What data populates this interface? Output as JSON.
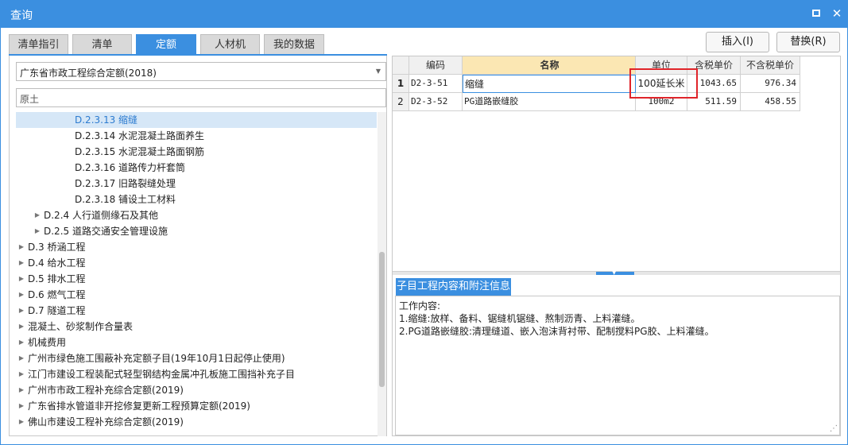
{
  "window": {
    "title": "查询"
  },
  "tabs": [
    {
      "label": "清单指引",
      "active": false
    },
    {
      "label": "清单",
      "active": false
    },
    {
      "label": "定额",
      "active": true
    },
    {
      "label": "人材机",
      "active": false
    },
    {
      "label": "我的数据",
      "active": false
    }
  ],
  "buttons": {
    "insert": "插入(I)",
    "replace": "替换(R)"
  },
  "left": {
    "quota_select": "广东省市政工程综合定额(2018)",
    "search_value": "原土",
    "tree": [
      {
        "label": "D.2.3.13 缩缝",
        "level": 3,
        "arrow": "",
        "selected": true
      },
      {
        "label": "D.2.3.14 水泥混凝土路面养生",
        "level": 3,
        "arrow": ""
      },
      {
        "label": "D.2.3.15 水泥混凝土路面钢筋",
        "level": 3,
        "arrow": ""
      },
      {
        "label": "D.2.3.16 道路传力杆套筒",
        "level": 3,
        "arrow": ""
      },
      {
        "label": "D.2.3.17 旧路裂缝处理",
        "level": 3,
        "arrow": ""
      },
      {
        "label": "D.2.3.18 铺设土工材料",
        "level": 3,
        "arrow": ""
      },
      {
        "label": "D.2.4 人行道侧缘石及其他",
        "level": 2,
        "arrow": "▶"
      },
      {
        "label": "D.2.5 道路交通安全管理设施",
        "level": 2,
        "arrow": "▶"
      },
      {
        "label": "D.3 桥涵工程",
        "level": 1,
        "arrow": "▶"
      },
      {
        "label": "D.4 给水工程",
        "level": 1,
        "arrow": "▶"
      },
      {
        "label": "D.5 排水工程",
        "level": 1,
        "arrow": "▶"
      },
      {
        "label": "D.6 燃气工程",
        "level": 1,
        "arrow": "▶"
      },
      {
        "label": "D.7 隧道工程",
        "level": 1,
        "arrow": "▶"
      },
      {
        "label": "混凝土、砂浆制作合量表",
        "level": 1,
        "arrow": "▶"
      },
      {
        "label": "机械费用",
        "level": 1,
        "arrow": "▶"
      },
      {
        "label": "广州市绿色施工围蔽补充定额子目(19年10月1日起停止使用)",
        "level": 1,
        "arrow": "▶"
      },
      {
        "label": "江门市建设工程装配式轻型钢结构金属冲孔板施工围挡补充子目",
        "level": 1,
        "arrow": "▶"
      },
      {
        "label": "广州市市政工程补充综合定额(2019)",
        "level": 1,
        "arrow": "▶"
      },
      {
        "label": "广东省排水管道非开挖修复更新工程预算定额(2019)",
        "level": 1,
        "arrow": "▶"
      },
      {
        "label": "佛山市建设工程补充综合定额(2019)",
        "level": 1,
        "arrow": "▶"
      }
    ]
  },
  "grid": {
    "headers": {
      "code": "编码",
      "name": "名称",
      "unit": "单位",
      "tax_price": "含税单价",
      "notax_price": "不含税单价"
    },
    "rows": [
      {
        "no": "1",
        "code": "D2-3-51",
        "name": "缩缝",
        "unit": "100延长米",
        "tax_price": "1043.65",
        "notax_price": "976.34"
      },
      {
        "no": "2",
        "code": "D2-3-52",
        "name": "PG道路嵌缝胶",
        "unit": "100m2",
        "tax_price": "511.59",
        "notax_price": "458.55"
      }
    ]
  },
  "info": {
    "tab_label": "子目工程内容和附注信息",
    "lines": [
      "工作内容:",
      "1.缩缝:放样、备料、锯缝机锯缝、熬制沥青、上料灌缝。",
      "2.PG道路嵌缝胶:清理缝道、嵌入泡沫背衬带、配制搅料PG胶、上料灌缝。"
    ]
  },
  "colors": {
    "accent": "#3b8fe0",
    "highlight_box": "#e0242a",
    "name_header": "#fbe7b3"
  }
}
